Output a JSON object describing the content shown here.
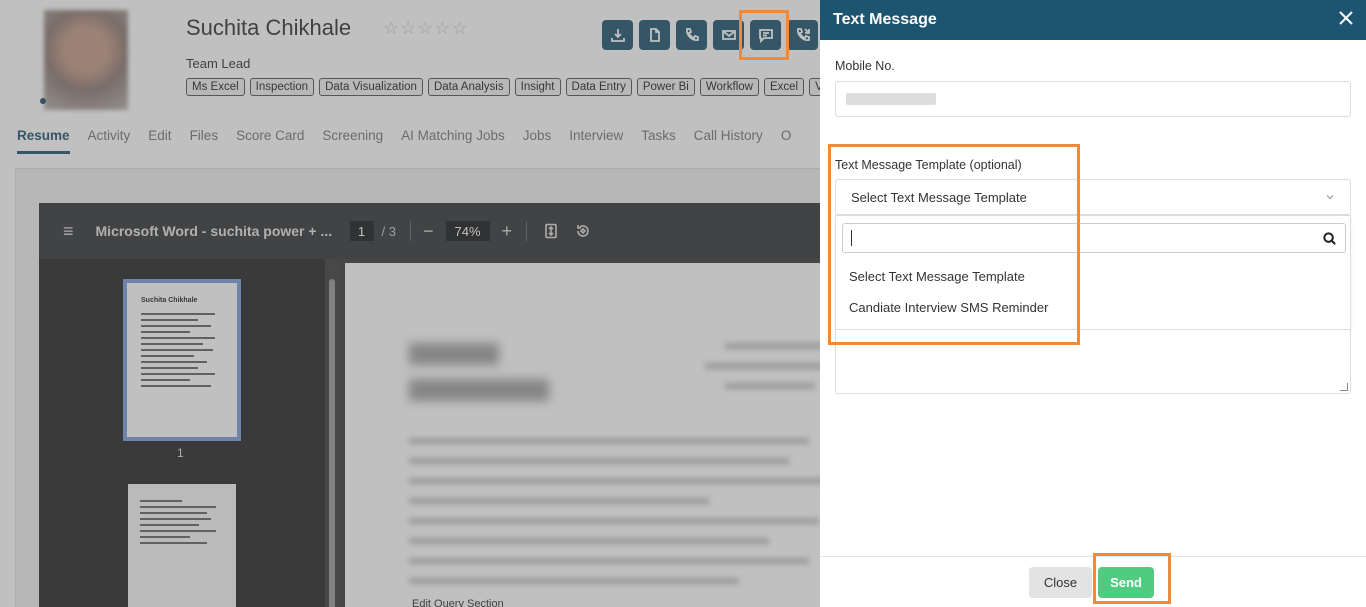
{
  "candidate": {
    "name": "Suchita Chikhale",
    "rating_stars": "☆☆☆☆☆",
    "role": "Team Lead",
    "skills": [
      "Ms Excel",
      "Inspection",
      "Data Visualization",
      "Data Analysis",
      "Insight",
      "Data Entry",
      "Power Bi",
      "Workflow",
      "Excel",
      "Visu"
    ]
  },
  "action_icons": [
    "download-icon",
    "document-icon",
    "phone-icon",
    "mail-icon",
    "message-icon",
    "call-history-icon"
  ],
  "tabs": [
    "Resume",
    "Activity",
    "Edit",
    "Files",
    "Score Card",
    "Screening",
    "AI Matching Jobs",
    "Jobs",
    "Interview",
    "Tasks",
    "Call History",
    "O"
  ],
  "active_tab": "Resume",
  "viewer": {
    "menu_icon": "≡",
    "title": "Microsoft Word - suchita power + ...",
    "page_current": "1",
    "page_separator": "/ 3",
    "zoom_minus": "−",
    "zoom_level": "74%",
    "zoom_plus": "+",
    "thumb_name": "Suchita Chikhale",
    "thumb_page": "1",
    "footer_text": "Edit Query Section"
  },
  "modal": {
    "title": "Text Message",
    "mobile_label": "Mobile No.",
    "mobile_value": "",
    "template_label": "Text Message Template (optional)",
    "template_selected": "Select Text Message Template",
    "search_value": "",
    "options": [
      "Select Text Message Template",
      "Candiate Interview SMS Reminder"
    ],
    "close_label": "Close",
    "send_label": "Send"
  },
  "colors": {
    "primary": "#1d5570",
    "send_button": "#4fcc7f",
    "highlight": "#f08a3a"
  }
}
